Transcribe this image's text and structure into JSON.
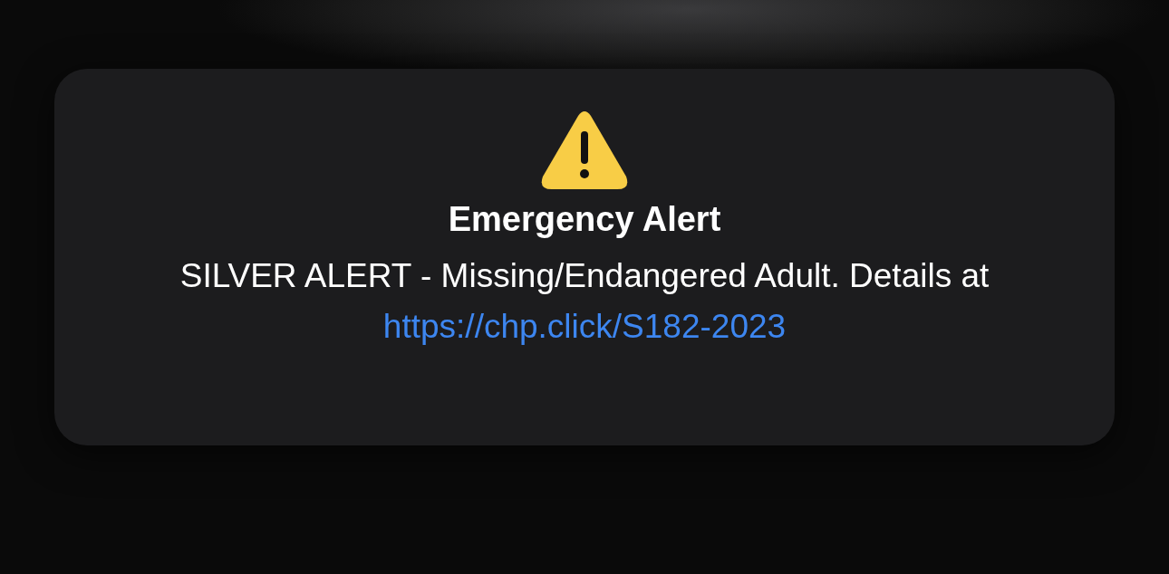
{
  "alert": {
    "title": "Emergency Alert",
    "message": "SILVER ALERT - Missing/Endangered Adult. Details at",
    "link": "https://chp.click/S182-2023"
  }
}
